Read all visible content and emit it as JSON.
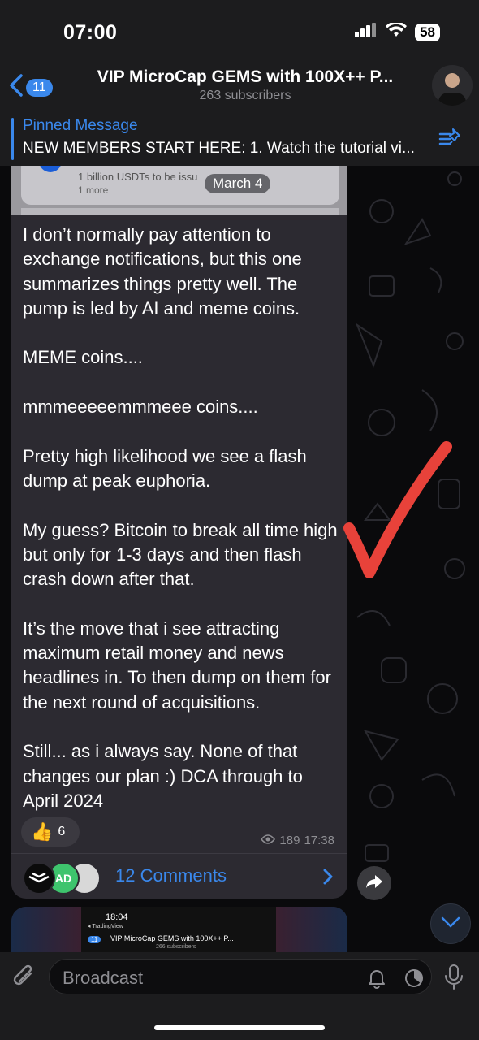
{
  "status_bar": {
    "time": "07:00",
    "battery": "58"
  },
  "header": {
    "back_count": "11",
    "title": "VIP MicroCap GEMS with 100X++ P...",
    "subtitle": "263 subscribers"
  },
  "pinned": {
    "title": "Pinned Message",
    "text": "NEW MEMBERS START HERE: 1. Watch the tutorial vi..."
  },
  "media_preview": {
    "line1": "1 billion USDTs to be issu",
    "line2": "1 more",
    "date": "March 4"
  },
  "message": {
    "text": "I don’t normally pay attention to exchange notifications, but this one summarizes things pretty well. The pump is led by AI and meme coins.\n\nMEME coins....\n\nmmmeeeeemmmeee coins....\n\nPretty high likelihood we see a flash dump at peak euphoria.\n\nMy guess? Bitcoin to break all time high but only for 1-3 days and then flash crash down after that.\n\nIt’s the move that i see attracting maximum retail money and news headlines in. To then dump on them for the next round of acquisitions.\n\nStill... as i always say. None of that changes our plan :) DCA through to April 2024",
    "reaction_emoji": "👍",
    "reaction_count": "6",
    "views": "189",
    "time": "17:38",
    "comments_label": "12 Comments",
    "commenter_initials": "AD"
  },
  "next_message": {
    "time": "18:04",
    "source": "◂ TradingView",
    "badge": "11",
    "title": "VIP MicroCap GEMS with 100X++ P...",
    "subtitle": "266 subscribers"
  },
  "composer": {
    "placeholder": "Broadcast"
  },
  "colors": {
    "accent": "#3a88ec",
    "bubble": "#2c2a31",
    "checkmark": "#e8423a"
  }
}
